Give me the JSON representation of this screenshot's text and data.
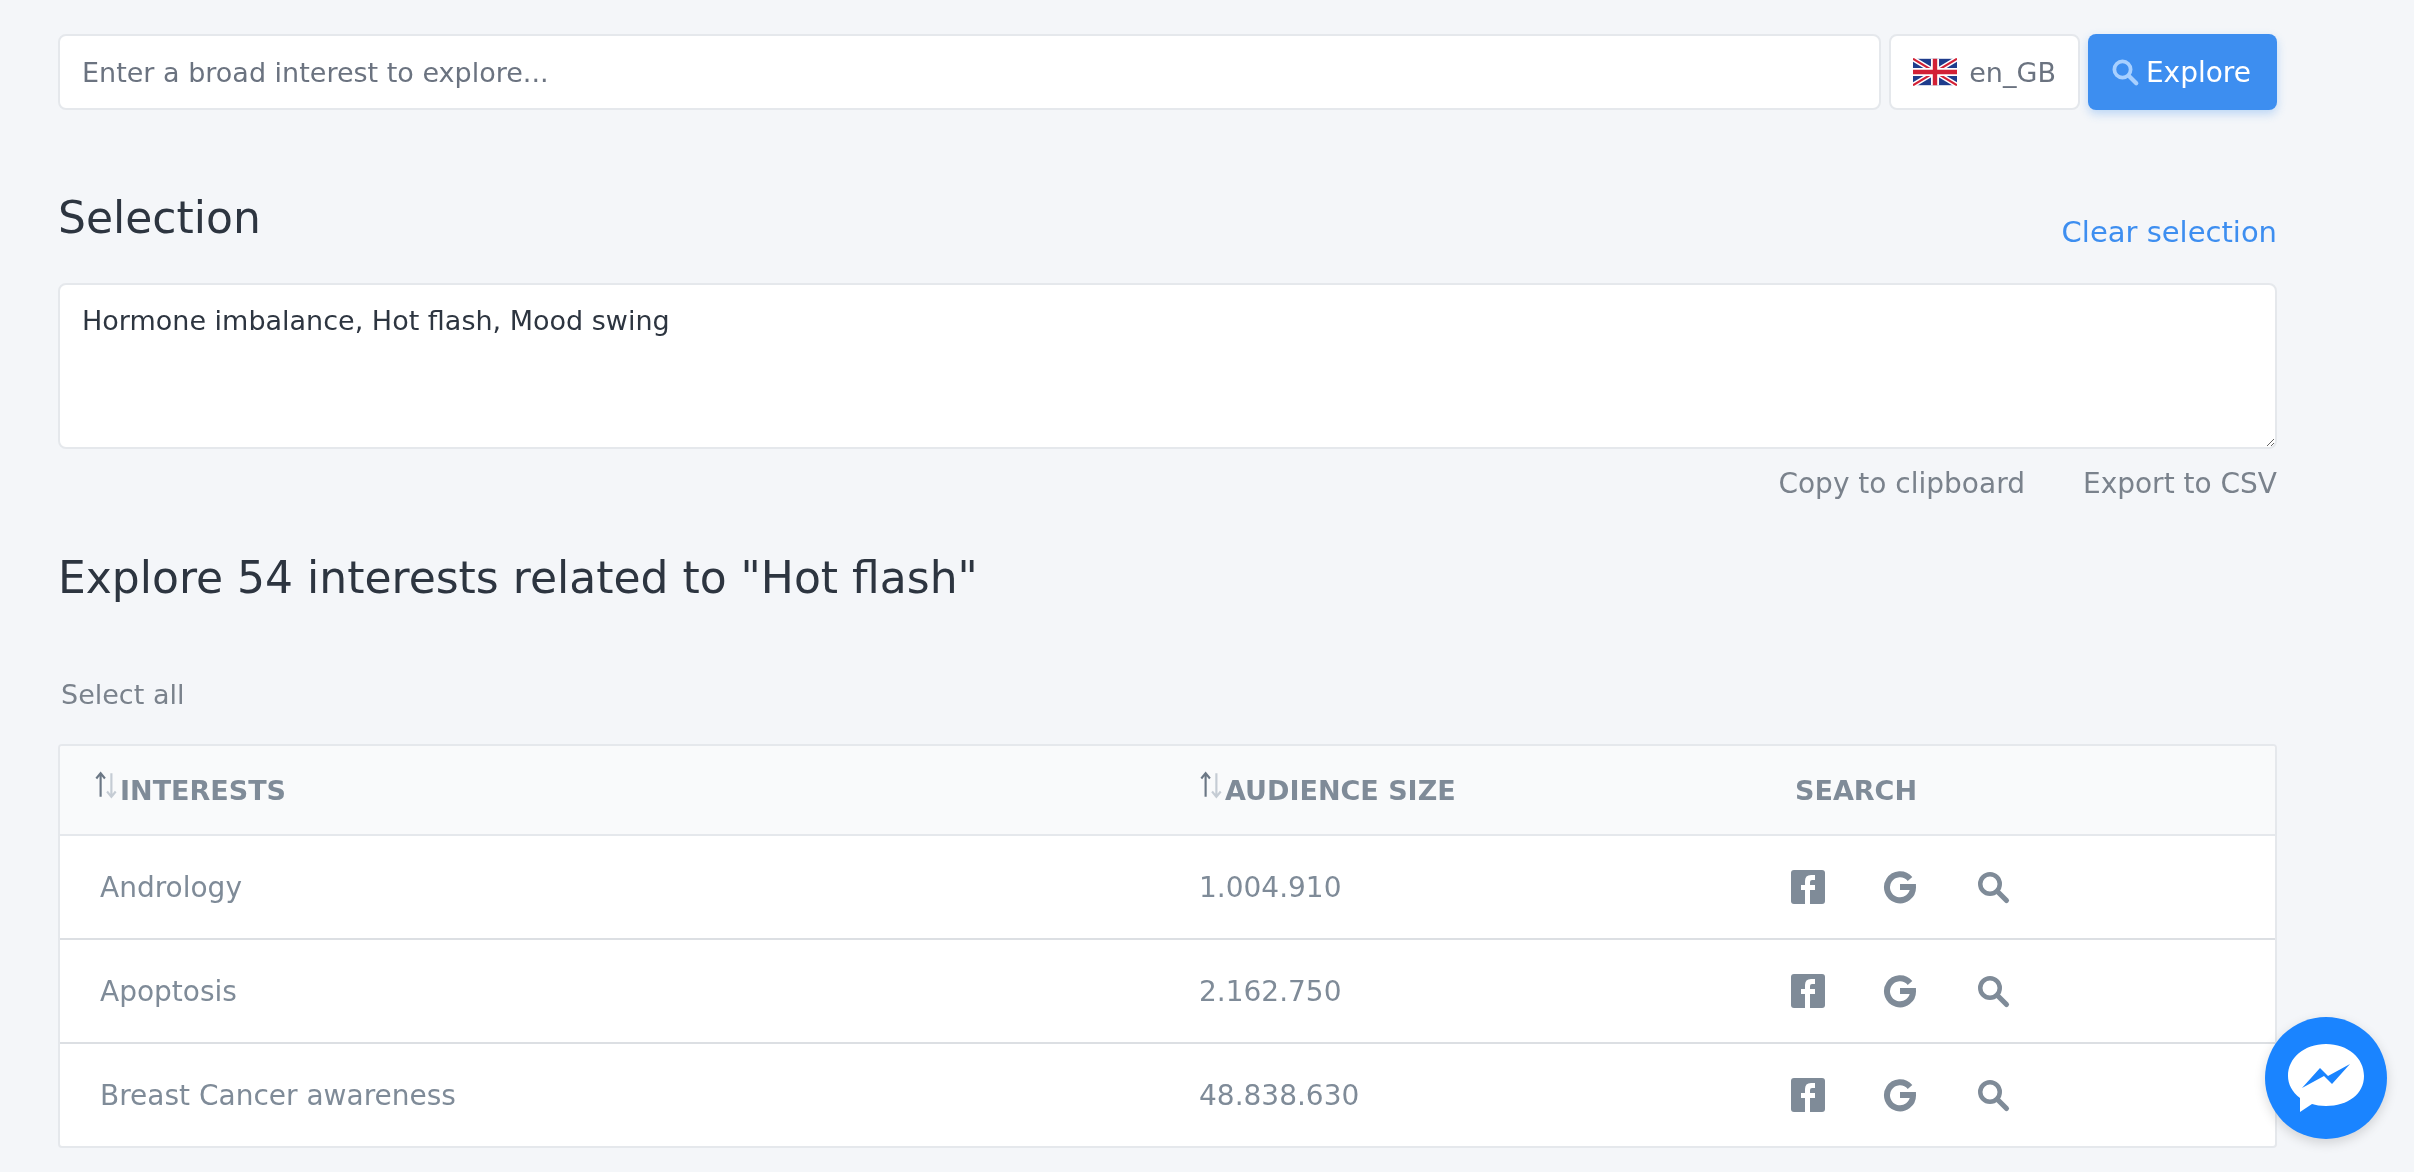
{
  "search": {
    "placeholder": "Enter a broad interest to explore...",
    "locale": "en_GB",
    "button": "Explore"
  },
  "selection": {
    "title": "Selection",
    "clear": "Clear selection",
    "value": "Hormone imbalance, Hot flash, Mood swing",
    "actions": [
      "Copy to clipboard",
      "Export to CSV"
    ]
  },
  "explore": {
    "title": "Explore 54 interests related to \"Hot flash\"",
    "select_all": "Select all"
  },
  "table": {
    "columns": [
      {
        "label": "INTERESTS",
        "sortable": true
      },
      {
        "label": "AUDIENCE SIZE",
        "sortable": true
      },
      {
        "label": "SEARCH",
        "sortable": false
      }
    ],
    "rows": [
      {
        "interest": "Andrology",
        "audience": "1.004.910"
      },
      {
        "interest": "Apoptosis",
        "audience": "2.162.750"
      },
      {
        "interest": "Breast Cancer awareness",
        "audience": "48.838.630"
      }
    ]
  }
}
